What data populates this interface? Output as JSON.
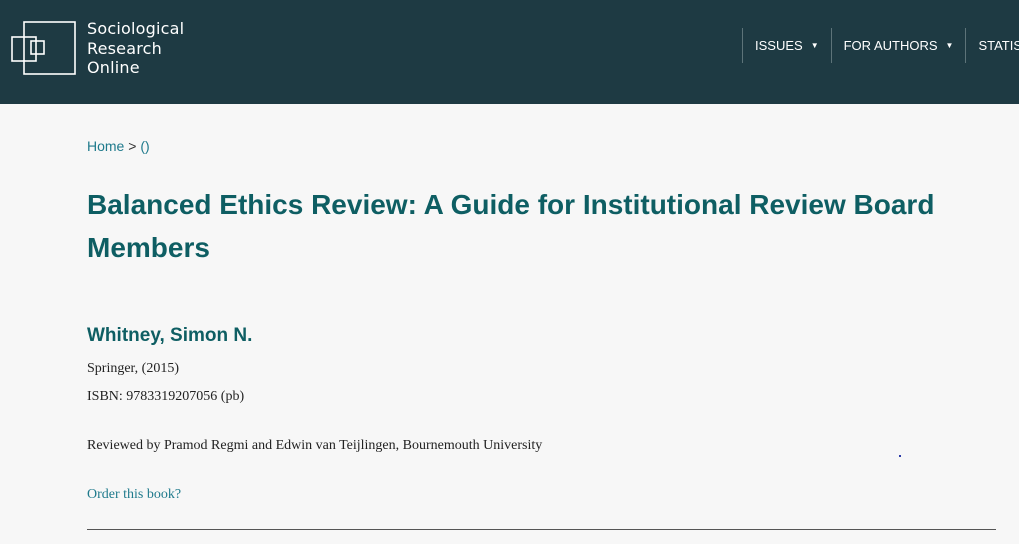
{
  "header": {
    "logo": {
      "line1": "Sociological",
      "line2": "Research",
      "line3": "Online"
    },
    "nav": [
      {
        "label": "ISSUES",
        "has_dropdown": true
      },
      {
        "label": "FOR AUTHORS",
        "has_dropdown": true
      },
      {
        "label": "STATISTICS",
        "has_dropdown": false
      }
    ],
    "colors": {
      "bar": "#1e3a43",
      "text": "#ffffff"
    }
  },
  "breadcrumb": {
    "home": "Home",
    "separator": ">",
    "current": "()"
  },
  "review": {
    "title": "Balanced Ethics Review: A Guide for Institutional Review Board Members",
    "author": "Whitney, Simon N.",
    "publisher": "Springer, (2015)",
    "isbn": "ISBN: 9783319207056 (pb)",
    "reviewed_by": "Reviewed by Pramod Regmi and Edwin van Teijlingen, Bournemouth University",
    "order_link": "Order this book?"
  },
  "colors": {
    "accent": "#0e5e63",
    "link": "#1f7a8c",
    "background": "#f7f7f7"
  }
}
